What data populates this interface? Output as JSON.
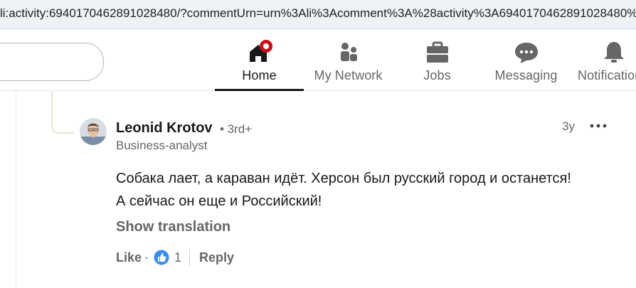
{
  "browser": {
    "url": "li:activity:6940170462891028480/?commentUrn=urn%3Ali%3Acomment%3A%28activity%3A6940170462891028480%"
  },
  "nav": {
    "home": "Home",
    "my_network": "My Network",
    "jobs": "Jobs",
    "messaging": "Messaging",
    "notifications": "Notifications"
  },
  "colors": {
    "brand_text": "#191919",
    "muted_text": "#666666",
    "notification_badge": "#cc1016",
    "like_blue": "#378fe9"
  },
  "comment": {
    "author_name": "Leonid Krotov",
    "degree": "• 3rd+",
    "headline": "Business-analyst",
    "time": "3y",
    "text_line1": "Собака лает, а караван идёт. Херсон был русский город и останется!",
    "text_line2": "А сейчас он еще и Российский!",
    "show_translation": "Show translation",
    "like_label": "Like",
    "separator": "·",
    "like_count": "1",
    "reply_label": "Reply"
  },
  "icons": {
    "home": "home-icon",
    "network": "people-icon",
    "jobs": "briefcase-icon",
    "messaging": "chat-bubble-icon",
    "notifications": "bell-icon",
    "more": "ellipsis-icon",
    "like_reaction": "thumbs-up-icon"
  }
}
